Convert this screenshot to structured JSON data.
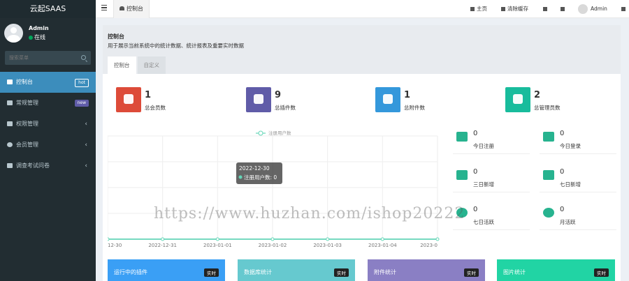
{
  "app": {
    "name": "云起SAAS"
  },
  "user": {
    "name": "Admin",
    "status": "在线"
  },
  "sidebar": {
    "search_placeholder": "搜索菜单",
    "items": [
      {
        "label": "控制台",
        "badge": "hot",
        "badge_color": "#3c8dbc"
      },
      {
        "label": "常规管理",
        "badge": "new",
        "badge_color": "#605ca8"
      },
      {
        "label": "权限管理"
      },
      {
        "label": "会员管理"
      },
      {
        "label": "调查考试问卷"
      }
    ]
  },
  "topbar": {
    "tab": "控制台",
    "home": "主页",
    "clear_cache": "清除缓存",
    "admin": "Admin"
  },
  "page": {
    "title": "控制台",
    "subtitle": "用于展示当前系统中的统计数据、统计报表及重要实时数据",
    "tabs": [
      "控制台",
      "自定义"
    ]
  },
  "stats": [
    {
      "value": "1",
      "label": "总会员数",
      "color": "#dd4b39",
      "icon": "users-icon"
    },
    {
      "value": "9",
      "label": "总插件数",
      "color": "#605ca8",
      "icon": "magic-icon"
    },
    {
      "value": "1",
      "label": "总附件数",
      "color": "#3498db",
      "icon": "leaf-icon"
    },
    {
      "value": "2",
      "label": "总管理员数",
      "color": "#18bc9c",
      "icon": "user-icon"
    }
  ],
  "side_stats": [
    {
      "value": "0",
      "label": "今日注册",
      "color": "#27b38f",
      "icon": "rocket-icon"
    },
    {
      "value": "0",
      "label": "今日登录",
      "color": "#27b38f",
      "icon": "vcard-icon"
    },
    {
      "value": "0",
      "label": "三日新增",
      "color": "#27b38f",
      "icon": "calendar-icon"
    },
    {
      "value": "0",
      "label": "七日新增",
      "color": "#27b38f",
      "icon": "calendar-plus-icon"
    },
    {
      "value": "0",
      "label": "七日活跃",
      "color": "#27b38f",
      "icon": "user-circle-icon"
    },
    {
      "value": "0",
      "label": "月活跃",
      "color": "#27b38f",
      "icon": "user-circle-icon"
    }
  ],
  "chart_data": {
    "type": "line",
    "legend": "注册用户数",
    "x": [
      "12-30",
      "2022-12-31",
      "2023-01-01",
      "2023-01-02",
      "2023-01-03",
      "2023-01-04",
      "2023-0"
    ],
    "series": [
      {
        "name": "注册用户数",
        "values": [
          0,
          0,
          0,
          0,
          0,
          0,
          0
        ]
      }
    ],
    "tooltip": {
      "date": "2022-12-30",
      "text": "注册用户数: 0"
    },
    "line_color": "#63d6b7"
  },
  "cards": [
    {
      "label": "运行中的插件",
      "badge": "实时",
      "color": "#3a9ff5"
    },
    {
      "label": "数据库统计",
      "badge": "实时",
      "color": "#66c9cf"
    },
    {
      "label": "附件统计",
      "badge": "实时",
      "color": "#8a7fc4"
    },
    {
      "label": "图片统计",
      "badge": "实时",
      "color": "#21d4a4"
    }
  ],
  "watermark": "https://www.huzhan.com/ishop20222"
}
